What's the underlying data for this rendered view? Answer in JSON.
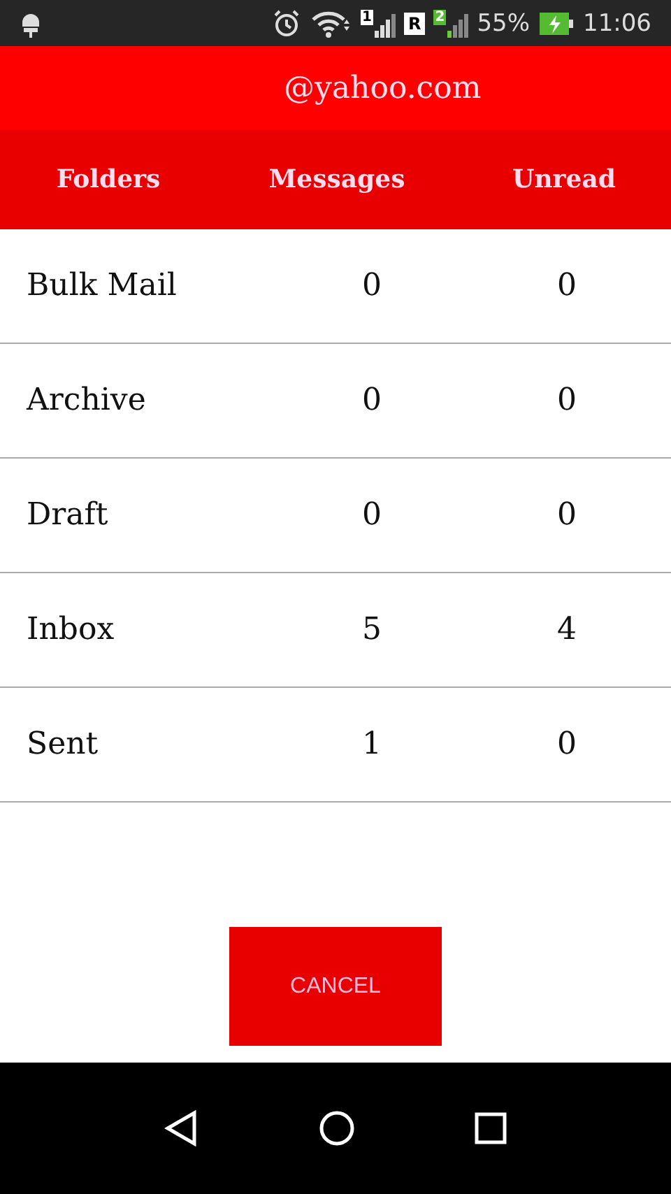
{
  "status_bar": {
    "sim_1": "1",
    "sim_2": "R",
    "sim_3": "2",
    "battery": "55%",
    "time": "11:06"
  },
  "account": {
    "email": "@yahoo.com"
  },
  "table": {
    "columns": [
      "Folders",
      "Messages",
      "Unread"
    ],
    "rows": [
      {
        "folder": "Bulk Mail",
        "messages": "0",
        "unread": "0"
      },
      {
        "folder": "Archive",
        "messages": "0",
        "unread": "0"
      },
      {
        "folder": "Draft",
        "messages": "0",
        "unread": "0"
      },
      {
        "folder": "Inbox",
        "messages": "5",
        "unread": "4"
      },
      {
        "folder": "Sent",
        "messages": "1",
        "unread": "0"
      }
    ]
  },
  "buttons": [
    "CANCEL"
  ]
}
